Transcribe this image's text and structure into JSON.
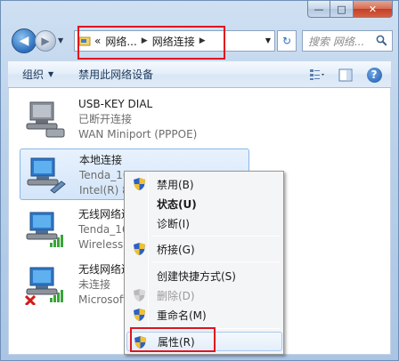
{
  "window": {
    "caption": {
      "minimize": "—",
      "maximize": "□",
      "close": "✕"
    }
  },
  "nav": {
    "back_glyph": "◀",
    "forward_glyph": "▶",
    "recent_glyph": "▼",
    "breadcrumb": [
      {
        "label": "«"
      },
      {
        "label": "网络..."
      },
      {
        "label": "网络连接"
      }
    ],
    "dropdown_glyph": "▼",
    "refresh_glyph": "↻",
    "search_placeholder": "搜索 网络..."
  },
  "toolbar": {
    "organize_label": "组织",
    "disable_label": "禁用此网络设备"
  },
  "connections": [
    {
      "name": "USB-KEY DIAL",
      "status": "已断开连接",
      "device": "WAN Miniport (PPPOE)"
    },
    {
      "name": "本地连接",
      "status": "Tenda_160",
      "device": "Intel(R) 82"
    },
    {
      "name": "无线网络连接",
      "status": "Tenda_160",
      "device": "Wireless 1"
    },
    {
      "name": "无线网络连接",
      "status": "未连接",
      "device": "Microsoft"
    }
  ],
  "context_menu": [
    {
      "label": "禁用(B)"
    },
    {
      "label": "状态(U)"
    },
    {
      "label": "诊断(I)"
    },
    {
      "label": "桥接(G)"
    },
    {
      "label": "创建快捷方式(S)"
    },
    {
      "label": "删除(D)"
    },
    {
      "label": "重命名(M)"
    },
    {
      "label": "属性(R)"
    }
  ],
  "colors": {
    "highlight_box": "#e0141e",
    "selection": "#d3e5f9",
    "toolbar_text": "#1e395b"
  }
}
